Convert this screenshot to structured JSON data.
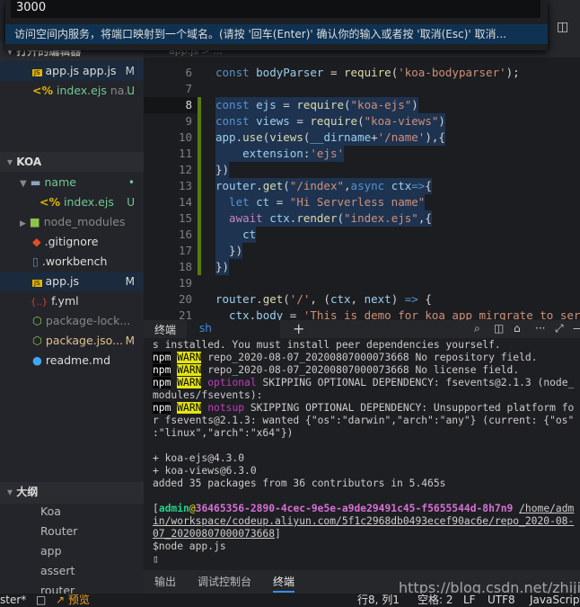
{
  "quick_input": {
    "value": "3000",
    "message": "访问空间内服务，将端口映射到一个域名。(请按 '回车(Enter)' 确认你的输入或者按 '取消(Esc)' 取消..."
  },
  "sidebar": {
    "open_editors_title": "打开的编辑器",
    "open_editors": [
      {
        "name": "app.js",
        "desc": "app.js",
        "badge": "M"
      },
      {
        "name": "index.ejs",
        "desc": "na...",
        "badge": "U"
      }
    ],
    "project_title": "KOA",
    "files": [
      {
        "name": "name",
        "badge": "•"
      },
      {
        "name": "index.ejs",
        "badge": "U"
      },
      {
        "name": "node_modules",
        "badge": ""
      },
      {
        "name": ".gitignore",
        "badge": ""
      },
      {
        "name": ".workbench",
        "badge": ""
      },
      {
        "name": "app.js",
        "badge": "M"
      },
      {
        "name": "f.yml",
        "badge": ""
      },
      {
        "name": "package-lock...",
        "badge": ""
      },
      {
        "name": "package.jso...",
        "badge": "M"
      },
      {
        "name": "readme.md",
        "badge": ""
      }
    ],
    "outline_title": "大纲",
    "outline": [
      "Koa",
      "Router",
      "app",
      "assert",
      "router"
    ]
  },
  "editor": {
    "breadcrumb": "app.js > ...",
    "lines": [
      {
        "n": "6",
        "t": [
          [
            "const ",
            "k"
          ],
          [
            "bodyParser",
            "v"
          ],
          [
            " = ",
            "t"
          ],
          [
            "require",
            "f"
          ],
          [
            "(",
            "t"
          ],
          [
            "'koa-bodyparser'",
            "s"
          ],
          [
            ");",
            "t"
          ]
        ]
      },
      {
        "n": "7",
        "t": []
      },
      {
        "n": "8",
        "t": [
          [
            "const ",
            "k"
          ],
          [
            "ejs",
            "v"
          ],
          [
            " = ",
            "t"
          ],
          [
            "require",
            "f"
          ],
          [
            "(",
            "t"
          ],
          [
            "\"koa-ejs\"",
            "s"
          ],
          [
            ")",
            "t"
          ]
        ]
      },
      {
        "n": "9",
        "t": [
          [
            "const ",
            "k"
          ],
          [
            "views",
            "v"
          ],
          [
            " = ",
            "t"
          ],
          [
            "require",
            "f"
          ],
          [
            "(",
            "t"
          ],
          [
            "\"koa-views\"",
            "s"
          ],
          [
            ")",
            "t"
          ]
        ]
      },
      {
        "n": "10",
        "t": [
          [
            "app",
            "v"
          ],
          [
            ".",
            "t"
          ],
          [
            "use",
            "f"
          ],
          [
            "(",
            "t"
          ],
          [
            "views",
            "f"
          ],
          [
            "(",
            "t"
          ],
          [
            "__dirname",
            "v"
          ],
          [
            "+",
            "t"
          ],
          [
            "'/name'",
            "s"
          ],
          [
            "),{",
            "t"
          ]
        ]
      },
      {
        "n": "11",
        "t": [
          [
            "    extension",
            "v"
          ],
          [
            ":",
            "t"
          ],
          [
            "'ejs'",
            "s"
          ]
        ]
      },
      {
        "n": "12",
        "t": [
          [
            "})",
            "t"
          ]
        ]
      },
      {
        "n": "13",
        "t": [
          [
            "router",
            "v"
          ],
          [
            ".",
            "t"
          ],
          [
            "get",
            "f"
          ],
          [
            "(",
            "t"
          ],
          [
            "\"/index\"",
            "s"
          ],
          [
            ",",
            "t"
          ],
          [
            "async ",
            "k"
          ],
          [
            "ctx",
            "v"
          ],
          [
            "=>",
            "k"
          ],
          [
            "{",
            "t"
          ]
        ]
      },
      {
        "n": "14",
        "t": [
          [
            "  let ",
            "k"
          ],
          [
            "ct",
            "v"
          ],
          [
            " = ",
            "t"
          ],
          [
            "\"Hi Serverless name\"",
            "s"
          ]
        ]
      },
      {
        "n": "15",
        "t": [
          [
            "  await ",
            "p"
          ],
          [
            "ctx",
            "v"
          ],
          [
            ".",
            "t"
          ],
          [
            "render",
            "f"
          ],
          [
            "(",
            "t"
          ],
          [
            "\"index.ejs\"",
            "s"
          ],
          [
            ",{",
            "t"
          ]
        ]
      },
      {
        "n": "16",
        "t": [
          [
            "    ct",
            "v"
          ]
        ]
      },
      {
        "n": "17",
        "t": [
          [
            "  })",
            "t"
          ]
        ]
      },
      {
        "n": "18",
        "t": [
          [
            "})",
            "t"
          ]
        ]
      },
      {
        "n": "19",
        "t": []
      },
      {
        "n": "20",
        "t": [
          [
            "router",
            "v"
          ],
          [
            ".",
            "t"
          ],
          [
            "get",
            "f"
          ],
          [
            "(",
            "t"
          ],
          [
            "'/'",
            "s"
          ],
          [
            ", (",
            "t"
          ],
          [
            "ctx",
            "v"
          ],
          [
            ", ",
            "t"
          ],
          [
            "next",
            "v"
          ],
          [
            ") ",
            "t"
          ],
          [
            "=>",
            "k"
          ],
          [
            " {",
            "t"
          ]
        ]
      },
      {
        "n": "21",
        "t": [
          [
            "  ctx",
            "v"
          ],
          [
            ".",
            "t"
          ],
          [
            "body",
            "v"
          ],
          [
            " = ",
            "t"
          ],
          [
            "'This is demo for koa app mirgrate to serve",
            "s"
          ]
        ]
      }
    ]
  },
  "terminal": {
    "tab_label": "终端",
    "shell_tab": "sh",
    "new": "+",
    "lines": [
      [
        [
          "s installed. You must install peer dependencies yourself.",
          ""
        ]
      ],
      [
        [
          "npm",
          "npm"
        ],
        [
          " ",
          ""
        ],
        [
          "WARN",
          "warn"
        ],
        [
          " repo_2020-08-07_20200807000073668 No repository field.",
          ""
        ]
      ],
      [
        [
          "npm",
          "npm"
        ],
        [
          " ",
          ""
        ],
        [
          "WARN",
          "warn"
        ],
        [
          " repo_2020-08-07_20200807000073668 No license field.",
          ""
        ]
      ],
      [
        [
          "npm",
          "npm"
        ],
        [
          " ",
          ""
        ],
        [
          "WARN",
          "warn"
        ],
        [
          " ",
          ""
        ],
        [
          "optional",
          "mag"
        ],
        [
          " SKIPPING OPTIONAL DEPENDENCY: fsevents@2.1.3 (node_",
          ""
        ]
      ],
      [
        [
          "modules/fsevents):",
          ""
        ]
      ],
      [
        [
          "npm",
          "npm"
        ],
        [
          " ",
          ""
        ],
        [
          "WARN",
          "warn"
        ],
        [
          " ",
          ""
        ],
        [
          "notsup",
          "mag"
        ],
        [
          " SKIPPING OPTIONAL DEPENDENCY: Unsupported platform fo",
          ""
        ]
      ],
      [
        [
          "r fsevents@2.1.3: wanted {\"os\":\"darwin\",\"arch\":\"any\"} (current: {\"os\"",
          ""
        ]
      ],
      [
        [
          ":\"linux\",\"arch\":\"x64\"})",
          ""
        ]
      ],
      [],
      [
        [
          "+ koa-ejs@4.3.0",
          ""
        ]
      ],
      [
        [
          "+ koa-views@6.3.0",
          ""
        ]
      ],
      [
        [
          "added 35 packages from 36 contributors in 5.465s",
          ""
        ]
      ],
      [],
      [
        [
          "[",
          ""
        ],
        [
          "admin",
          "grn"
        ],
        [
          "@",
          "f"
        ],
        [
          "36465356-2890-4cec-9e5e-a9de29491c45-f5655544d-8h7n9",
          "pur"
        ],
        [
          " ",
          ""
        ],
        [
          "/home/adm",
          "ul"
        ]
      ],
      [
        [
          "in/workspace/codeup.aliyun.com/5f1c2968db0493ecef90ac6e/repo_2020-08-",
          "ul"
        ]
      ],
      [
        [
          "07_20200807000073668",
          "ul"
        ],
        [
          "]",
          ""
        ]
      ],
      [
        [
          "$node app.js",
          ""
        ]
      ],
      [
        [
          "▯",
          ""
        ]
      ]
    ]
  },
  "panel_tabs": [
    "输出",
    "调试控制台",
    "终端"
  ],
  "watermark": "https://blog.csdn.net/zhijiex",
  "status": {
    "branch": "ster*",
    "preview": "预览",
    "position": "行8, 列1",
    "spaces": "空格: 2",
    "eol": "LF",
    "encoding": "UTF8",
    "language": "JavaScript"
  }
}
